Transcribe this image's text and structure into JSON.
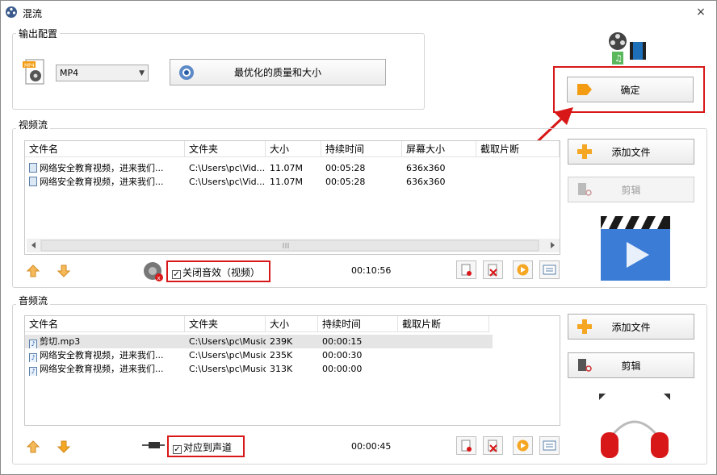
{
  "window": {
    "title": "混流",
    "close_glyph": "×"
  },
  "output": {
    "group_label": "输出配置",
    "format_value": "MP4",
    "quality_button": "最优化的质量和大小",
    "ok_button": "确定"
  },
  "video": {
    "group_label": "视频流",
    "columns": [
      "文件名",
      "文件夹",
      "大小",
      "持续时间",
      "屏幕大小",
      "截取片断"
    ],
    "rows": [
      {
        "name": "网络安全教育视频，进来我们...",
        "folder": "C:\\Users\\pc\\Vid...",
        "size": "11.07M",
        "duration": "00:05:28",
        "screen": "636x360",
        "clip": ""
      },
      {
        "name": "网络安全教育视频，进来我们...",
        "folder": "C:\\Users\\pc\\Vid...",
        "size": "11.07M",
        "duration": "00:05:28",
        "screen": "636x360",
        "clip": ""
      }
    ],
    "mute_label": "关闭音效（视频）",
    "total_time": "00:10:56",
    "add_button": "添加文件",
    "cut_button": "剪辑"
  },
  "audio": {
    "group_label": "音频流",
    "columns": [
      "文件名",
      "文件夹",
      "大小",
      "持续时间",
      "截取片断"
    ],
    "rows": [
      {
        "name": "剪切.mp3",
        "folder": "C:\\Users\\pc\\Music",
        "size": "239K",
        "duration": "00:00:15",
        "clip": ""
      },
      {
        "name": "网络安全教育视频，进来我们...",
        "folder": "C:\\Users\\pc\\Music",
        "size": "235K",
        "duration": "00:00:30",
        "clip": ""
      },
      {
        "name": "网络安全教育视频，进来我们...",
        "folder": "C:\\Users\\pc\\Music",
        "size": "313K",
        "duration": "00:00:00",
        "clip": ""
      }
    ],
    "channel_label": "对应到声道",
    "total_time": "00:00:45",
    "add_button": "添加文件",
    "cut_button": "剪辑"
  },
  "colors": {
    "highlight_red": "#d81818",
    "accent_orange": "#f5a623"
  }
}
